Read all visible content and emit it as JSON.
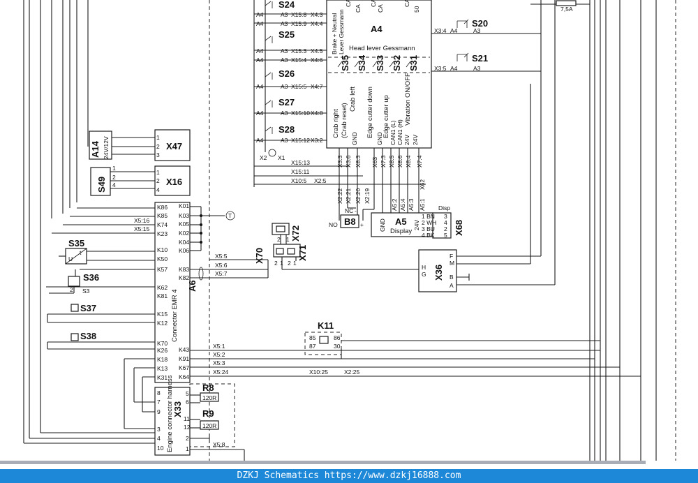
{
  "diagram": {
    "components": {
      "A4": {
        "id": "A4",
        "desc": "Head lever Gessmann",
        "side_label": "Brake + Neutral",
        "side_label2": "Lever Gessmann",
        "switches": [
          "S35",
          "S34",
          "S33",
          "S32",
          "S31"
        ],
        "functions": [
          "Crab right",
          "(Crab reset)",
          "Crab left",
          "GND",
          "Edge cutter down",
          "Edge cutter up",
          "GND",
          "CAN1 (L)",
          "CAN1 (H)",
          "24V",
          "Vibration ON/OFF",
          "24V"
        ],
        "top_pins": [
          "CA",
          "CA",
          "CA",
          "CA",
          "CA",
          "50"
        ],
        "pins": [
          "X3:3",
          "X3:6",
          "X8:3",
          "X63",
          "X7:3",
          "X8:5",
          "X8:6",
          "X8:4",
          "X7:4"
        ]
      },
      "A6": {
        "id": "A6",
        "desc": "Connector EMR 4",
        "pins_left": [
          "K86",
          "K85",
          "K74",
          "K23",
          "K10",
          "K50",
          "K57",
          "K62",
          "K81",
          "K15",
          "K12",
          "K70",
          "K26",
          "K18",
          "K13",
          "K31"
        ],
        "pins_right": [
          "K01",
          "K03",
          "K05",
          "K02",
          "K04",
          "K06",
          "K83",
          "K82",
          "K43",
          "K91",
          "K67",
          "K64"
        ]
      },
      "A5": {
        "id": "A5",
        "desc": "Display",
        "pins": [
          "GND",
          "24V",
          "A5:2",
          "A5:4",
          "A5:3",
          "A5:1"
        ]
      },
      "A14": {
        "id": "A14",
        "desc": "24V/12V"
      },
      "X47": {
        "id": "X47",
        "pins": [
          "1",
          "2",
          "3"
        ]
      },
      "X16": {
        "id": "X16",
        "pins": [
          "1",
          "2",
          "4"
        ]
      },
      "S49": {
        "id": "S49",
        "pins": [
          "1",
          "2",
          "4"
        ]
      },
      "X68": {
        "id": "X68",
        "title": "Disp",
        "pins": [
          "1 BN",
          "2 WH",
          "3 BU",
          "4 BK"
        ],
        "sockets": [
          "3",
          "4",
          "2",
          "5"
        ]
      },
      "X36": {
        "id": "X36",
        "pins": [
          "F",
          "M",
          "H",
          "G",
          "B",
          "A"
        ]
      },
      "B8": {
        "id": "B8",
        "labels": [
          "NO",
          "NC",
          "-",
          "+"
        ]
      },
      "K11": {
        "id": "K11",
        "pins": [
          "85",
          "86",
          "87",
          "30"
        ]
      },
      "X33": {
        "id": "X33",
        "desc": "Engine connector harness",
        "pins_left": [
          "8",
          "7",
          "9",
          "3",
          "4",
          "10"
        ],
        "pins_right": [
          "5",
          "6",
          "11",
          "12",
          "2",
          "1"
        ]
      },
      "R8": {
        "id": "R8",
        "value": "120R"
      },
      "R9": {
        "id": "R9",
        "value": "120R"
      },
      "X70": {
        "id": "X70"
      },
      "X71": {
        "id": "X71"
      },
      "X72": {
        "id": "X72"
      },
      "S20": {
        "id": "S20"
      },
      "S21": {
        "id": "S21"
      },
      "S24": {
        "id": "S24"
      },
      "S25": {
        "id": "S25"
      },
      "S26": {
        "id": "S26"
      },
      "S27": {
        "id": "S27"
      },
      "S28": {
        "id": "S28"
      },
      "S35": {
        "id": "S35"
      },
      "S36": {
        "id": "S36"
      },
      "S37": {
        "id": "S37"
      },
      "S38": {
        "id": "S38"
      }
    },
    "switch_rows": [
      {
        "id": "S24",
        "a4": "A4",
        "a3": "A3",
        "ref": "X15:8",
        "to": "X4:3"
      },
      {
        "id": "",
        "a4": "A4",
        "a3": "A3",
        "ref": "X15:9",
        "to": "X4:4"
      },
      {
        "id": "S25",
        "a4": "A4",
        "a3": "A3",
        "ref": "X15:3",
        "to": "X4:5"
      },
      {
        "id": "",
        "a4": "A4",
        "a3": "A3",
        "ref": "X15:4",
        "to": "X4:6"
      },
      {
        "id": "S26",
        "a4": "A4",
        "a3": "A3",
        "ref": "X15:5",
        "to": "X4:7"
      },
      {
        "id": "S27",
        "a4": "A4",
        "a3": "A3",
        "ref": "X15:10",
        "to": "X4:8"
      },
      {
        "id": "S28",
        "a4": "A4",
        "a3": "A3",
        "ref": "X15:12",
        "to": "X3:2"
      }
    ],
    "right_switches": [
      {
        "id": "S20",
        "ref": "X3:4",
        "a4": "A4",
        "a3": "A3"
      },
      {
        "id": "S21",
        "ref": "X3:5",
        "a4": "A4",
        "a3": "A3"
      }
    ],
    "refs": {
      "x15_13": "X15:13",
      "x15_11": "X15:11",
      "x10_5": "X10:5",
      "x2_5": "X2:5",
      "x2_22": "X2:22",
      "x2_21": "X2:21",
      "x2_20": "X2:20",
      "x2_19": "X2:19",
      "x62": "X62",
      "x5_16": "X5:16",
      "x5_15": "X5:15",
      "x5_5": "X5:5",
      "x5_6": "X5:6",
      "x5_7": "X5:7",
      "x5_1": "X5:1",
      "x5_2": "X5:2",
      "x5_3": "X5:3",
      "x5_24": "X5:24",
      "x10_25": "X10:25",
      "x2_25": "X2:25",
      "x5_8": "X5:8",
      "x2": "X2",
      "x1": "X1",
      "s3": "S3"
    },
    "fuse": "7,5A",
    "ground_marker": "T"
  },
  "footer": {
    "text": "DZKJ Schematics https://www.dzkj16888.com"
  }
}
